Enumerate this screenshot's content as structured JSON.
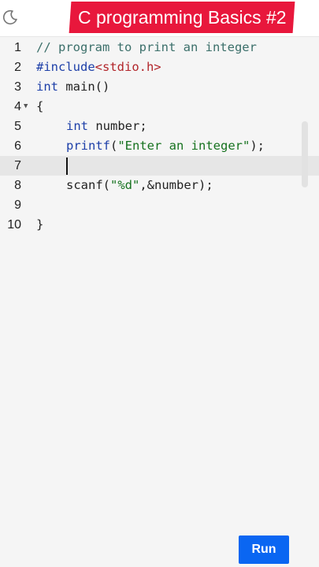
{
  "header": {
    "title": "C programming Basics #2",
    "theme_icon": "moon-icon"
  },
  "editor": {
    "line_numbers": [
      "1",
      "2",
      "3",
      "4",
      "5",
      "6",
      "7",
      "8",
      "9",
      "10"
    ],
    "active_line": "7",
    "lines": {
      "l1_comment": "// program to print an integer",
      "l2_include": "#include",
      "l2_header": "<stdio.h>",
      "l3_type": "int",
      "l3_rest": " main()",
      "l4_brace": "{",
      "l5_type": "int",
      "l5_rest": " number;",
      "l6_fn": "printf",
      "l6_open": "(",
      "l6_str": "\"Enter an integer\"",
      "l6_close": ");",
      "l8_fn": "scanf(",
      "l8_str": "\"%d\"",
      "l8_rest": ",&number);",
      "l10_brace": "}"
    }
  },
  "actions": {
    "run_label": "Run"
  },
  "colors": {
    "banner": "#e8173c",
    "run_button": "#0a66f2",
    "comment": "#3b6f6a",
    "keyword": "#1d3fa8",
    "header_file": "#b2252a",
    "string": "#16721f"
  }
}
